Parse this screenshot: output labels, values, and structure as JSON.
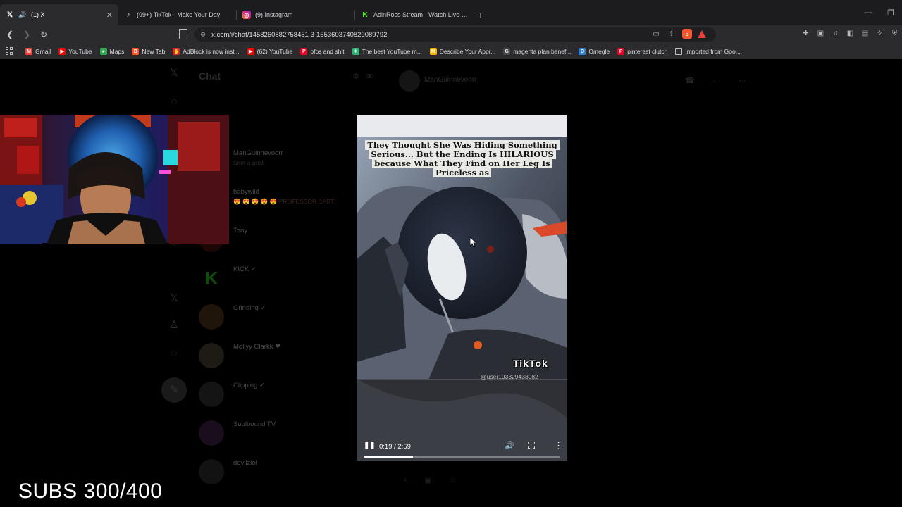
{
  "browser": {
    "tabs": [
      {
        "label": "(1) X",
        "favicon": "X",
        "active": true
      },
      {
        "label": "(99+) TikTok - Make Your Day",
        "favicon": "♪",
        "active": false
      },
      {
        "label": "(9) Instagram",
        "favicon": "◎",
        "active": false
      },
      {
        "label": "AdinRoss Stream - Watch Live on Kick",
        "favicon": "K",
        "active": false
      }
    ],
    "url": "x.com/i/chat/1458260882758451 3-1553603740829089792",
    "window_controls": {
      "minimize": "—",
      "restore": "❐"
    },
    "bookmarks": [
      {
        "label": "Gmail",
        "icon": "gmail-icon",
        "color": "#ea4335",
        "glyph": "M"
      },
      {
        "label": "YouTube",
        "icon": "youtube-icon",
        "color": "#ff0000",
        "glyph": "▶"
      },
      {
        "label": "Maps",
        "icon": "maps-icon",
        "color": "#34a853",
        "glyph": "●"
      },
      {
        "label": "New Tab",
        "icon": "brave-icon",
        "color": "#fb542b",
        "glyph": "B"
      },
      {
        "label": "AdBlock is now inst...",
        "icon": "adblock-icon",
        "color": "#e0262b",
        "glyph": "✋"
      },
      {
        "label": "(62) YouTube",
        "icon": "youtube-icon",
        "color": "#ff0000",
        "glyph": "▶"
      },
      {
        "label": "pfps and shit",
        "icon": "pinterest-icon",
        "color": "#e60023",
        "glyph": "P"
      },
      {
        "label": "The best YouTube m...",
        "icon": "leaf-icon",
        "color": "#2bb673",
        "glyph": "✦"
      },
      {
        "label": "Describe Your Appr...",
        "icon": "gmail-icon",
        "color": "#f4b400",
        "glyph": "M"
      },
      {
        "label": "magenta plan benef...",
        "icon": "google-icon",
        "color": "#444444",
        "glyph": "G"
      },
      {
        "label": "Omegle",
        "icon": "omegle-icon",
        "color": "#2d7fd6",
        "glyph": "O"
      },
      {
        "label": "pinterest clutch",
        "icon": "pinterest-icon",
        "color": "#e60023",
        "glyph": "P"
      },
      {
        "label": "Imported from Goo...",
        "icon": "folder-icon",
        "color": "#666666",
        "glyph": ""
      }
    ]
  },
  "chat": {
    "title": "Chat",
    "header_name": "ManGuinnevoorr",
    "conversations": [
      {
        "name": "ManGuinnevoorr",
        "preview": "Sent a post",
        "avatar_color": "#161616"
      },
      {
        "name": "babywild",
        "preview": "😍 😍 😍 😍 😍 PROFESSOR CARTI",
        "avatar_color": "#161616"
      },
      {
        "name": "Tony",
        "preview": "",
        "avatar_color": "#1d0606"
      },
      {
        "name": "KICK ✓",
        "preview": "",
        "avatar_color": "#0a2a08"
      },
      {
        "name": "Grinding ✓",
        "preview": "",
        "avatar_color": "#1f150a"
      },
      {
        "name": "Mollyy Clarkk ❤",
        "preview": "",
        "avatar_color": "#1e1a14"
      },
      {
        "name": "Clipping ✓",
        "preview": "",
        "avatar_color": "#141414"
      },
      {
        "name": "Soulbound TV",
        "preview": "",
        "avatar_color": "#1a0d1d"
      },
      {
        "name": "devilzlol",
        "preview": "",
        "avatar_color": "#121212"
      }
    ]
  },
  "video": {
    "caption": "They Thought She Was Hiding Something Serious... But the Ending Is HILARIOUS because What They Find on Her Leg Is Priceless as",
    "watermark": "TikTok",
    "handle": "@user193329438082",
    "time": "0:19 / 2:59",
    "progress": 0.25
  },
  "overlay": {
    "subs": "SUBS 300/400"
  }
}
